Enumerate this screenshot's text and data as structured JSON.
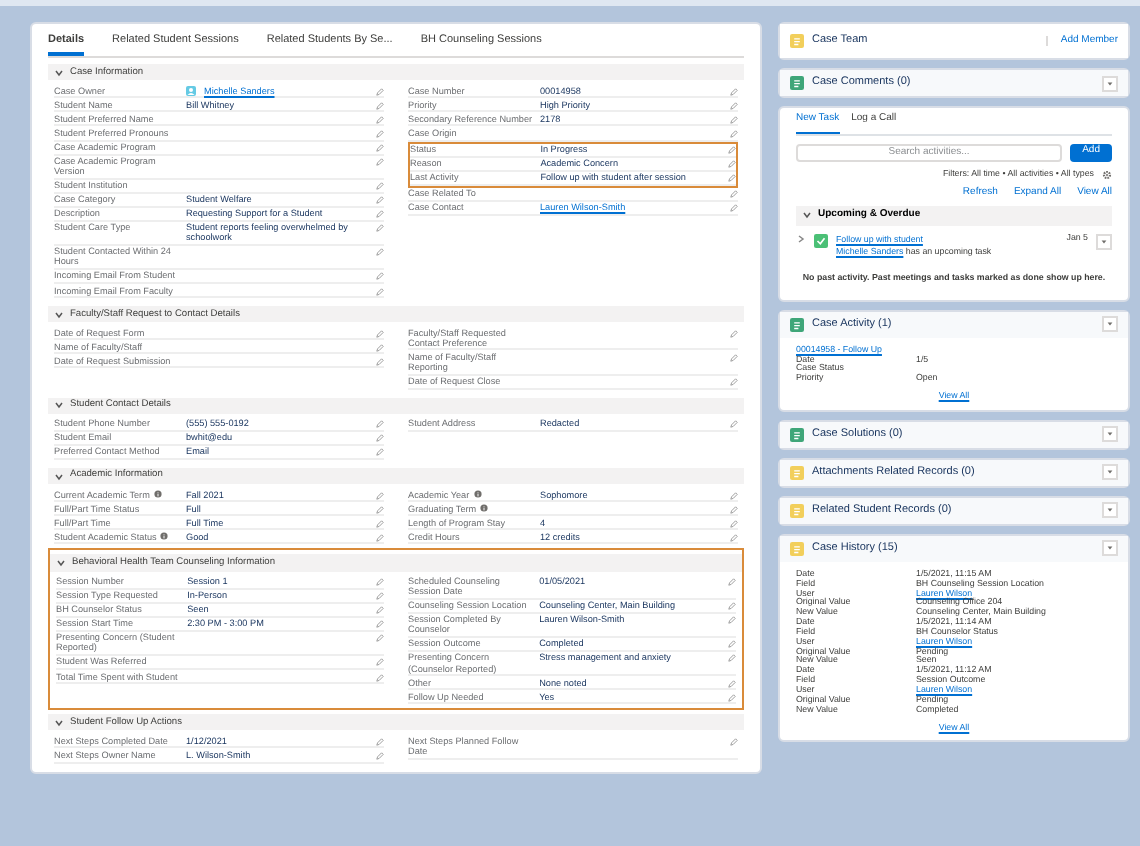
{
  "tabs": [
    {
      "label": "Details",
      "selected": true
    },
    {
      "label": "Related Student Sessions",
      "selected": false
    },
    {
      "label": "Related Students By Se...",
      "selected": false
    },
    {
      "label": "BH Counseling Sessions",
      "selected": false
    }
  ],
  "sections": [
    {
      "title": "Case Information",
      "expanded": true,
      "left": [
        {
          "label": "Case Owner",
          "value": "Michelle Sanders",
          "link": true,
          "user": true
        },
        {
          "label": "Student Name",
          "value": "Bill Whitney"
        },
        {
          "label": "Student Preferred Name"
        },
        {
          "label": "Student Preferred Pronouns"
        },
        {
          "label": "Case Academic Program"
        },
        {
          "label": "Case Academic Program Version"
        },
        {
          "label": "Student Institution"
        },
        {
          "label": "Case Category",
          "value": "Student Welfare"
        },
        {
          "label": "Description",
          "value": "Requesting Support for a Student"
        },
        {
          "label": "Student Care Type",
          "value": "Student reports feeling overwhelmed by schoolwork"
        },
        {
          "label": "Student Contacted Within 24 Hours"
        },
        {
          "label": "Incoming Email From Student"
        },
        {
          "label": "Incoming Email From Faculty"
        }
      ],
      "right": [
        {
          "label": "Case Number",
          "value": "00014958"
        },
        {
          "label": "Priority",
          "value": "High Priority"
        },
        {
          "label": "Secondary Reference Number",
          "value": "2178"
        },
        {
          "label": "Case Origin"
        },
        {
          "label": "Status",
          "value": "In Progress",
          "highlighted": true
        },
        {
          "label": "Reason",
          "value": "Academic Concern",
          "highlighted": true
        },
        {
          "label": "Last Activity",
          "value": "Follow up with student after session",
          "highlighted": true
        },
        {
          "label": "Case Related To"
        },
        {
          "label": "Case Contact",
          "value": "Lauren Wilson-Smith",
          "link": true
        }
      ]
    },
    {
      "title": "Faculty/Staff Request to Contact Details",
      "expanded": true,
      "left": [
        {
          "label": "Date of Request Form"
        },
        {
          "label": "Name of Faculty/Staff"
        },
        {
          "label": "Date of Request Submission"
        }
      ],
      "right": [
        {
          "label": "Faculty/Staff Requested Contact Preference"
        },
        {
          "label": "Name of Faculty/Staff Reporting"
        },
        {
          "label": "Date of Request Close"
        }
      ]
    },
    {
      "title": "Student Contact Details",
      "expanded": true,
      "left": [
        {
          "label": "Student Phone Number",
          "value": "(555) 555-0192"
        },
        {
          "label": "Student Email",
          "value": "bwhit@edu"
        },
        {
          "label": "Preferred Contact Method",
          "value": "Email"
        }
      ],
      "right": [
        {
          "label": "Student Address",
          "value": "Redacted"
        }
      ]
    },
    {
      "title": "Academic Information",
      "expanded": true,
      "left": [
        {
          "label": "Current Academic Term",
          "info": true,
          "value": "Fall 2021"
        },
        {
          "label": "Full/Part Time Status",
          "value": "Full"
        },
        {
          "label": "Full/Part Time",
          "value": "Full Time"
        },
        {
          "label": "Student Academic Status",
          "info": true,
          "value": "Good"
        }
      ],
      "right": [
        {
          "label": "Academic Year",
          "info": true,
          "value": "Sophomore"
        },
        {
          "label": "Graduating Term",
          "info": true
        },
        {
          "label": "Length of Program Stay",
          "value": "4"
        },
        {
          "label": "Credit Hours",
          "value": "12 credits"
        }
      ]
    },
    {
      "title": "Behavioral Health Team Counseling Information",
      "expanded": true,
      "highlighted": true,
      "left": [
        {
          "label": "Session Number",
          "value": "Session 1"
        },
        {
          "label": "Session Type Requested",
          "value": "In-Person"
        },
        {
          "label": "BH Counselor Status",
          "value": "Seen"
        },
        {
          "label": "Session Start Time",
          "value": "2:30 PM - 3:00 PM"
        },
        {
          "label": "Presenting Concern (Student Reported)"
        },
        {
          "label": "Student Was Referred"
        },
        {
          "label": "Total Time Spent with Student"
        }
      ],
      "right": [
        {
          "label": "Scheduled Counseling Session Date",
          "value": "01/05/2021"
        },
        {
          "label": "Counseling Session Location",
          "value": "Counseling Center, Main Building"
        },
        {
          "label": "Session Completed By Counselor",
          "value": "Lauren Wilson-Smith"
        },
        {
          "label": "Session Outcome",
          "value": "Completed"
        },
        {
          "label": "Presenting Concern (Counselor Reported)",
          "value": "Stress management and anxiety"
        },
        {
          "label": "Other",
          "value": "None noted"
        },
        {
          "label": "Follow Up Needed",
          "value": "Yes"
        }
      ]
    },
    {
      "title": "Student Follow Up Actions",
      "expanded": true,
      "left": [
        {
          "label": "Next Steps Completed Date",
          "value": "1/12/2021"
        },
        {
          "label": "Next Steps Owner Name",
          "value": "L. Wilson-Smith"
        }
      ],
      "right": [
        {
          "label": "Next Steps Planned Follow Date"
        }
      ]
    }
  ],
  "side_cards": [
    {
      "kind": "team",
      "title": "Case Team",
      "color": "#f2cf5b",
      "action": "Add Member"
    },
    {
      "kind": "header",
      "title": "Case Comments (0)",
      "color": "#3fa679"
    },
    {
      "kind": "activity",
      "tabs": [
        {
          "label": "New Task",
          "selected": true
        },
        {
          "label": "Log a Call",
          "selected": false
        }
      ],
      "placeholder": "Search activities...",
      "button": "Add",
      "filter": "Filters: All time • All activities • All types",
      "links": [
        "Refresh",
        "Expand All",
        "View All"
      ],
      "group": "Upcoming & Overdue",
      "items": [
        {
          "title": "Follow up with student",
          "who": "Michelle Sanders",
          "rest": "has an upcoming task",
          "date": "Jan 5"
        }
      ],
      "empty": "No past activity. Past meetings and tasks marked as done show up here."
    },
    {
      "kind": "list",
      "title": "Case Activity (1)",
      "color": "#3fa679",
      "records": [
        {
          "link": "00014958 - Follow Up",
          "fields": [
            {
              "label": "Date",
              "value": "1/5"
            },
            {
              "label": "Case Status"
            },
            {
              "label": "Priority",
              "value": "Open"
            }
          ]
        }
      ],
      "footer": "View All"
    },
    {
      "kind": "header",
      "title": "Case Solutions (0)",
      "color": "#3fa679"
    },
    {
      "kind": "header",
      "title": "Attachments Related Records (0)",
      "color": "#f2cf5b"
    },
    {
      "kind": "header",
      "title": "Related Student Records (0)",
      "color": "#f2cf5b"
    },
    {
      "kind": "list",
      "title": "Case History (15)",
      "color": "#f2cf5b",
      "records": [
        {
          "fields": [
            {
              "label": "Date",
              "value": "1/5/2021, 11:15 AM"
            },
            {
              "label": "Field",
              "value": "BH Counseling Session Location"
            },
            {
              "label": "User",
              "value": "Lauren Wilson",
              "link": true
            },
            {
              "label": "Original Value",
              "value": "Counseling Office 204"
            },
            {
              "label": "New Value",
              "value": "Counseling Center, Main Building"
            }
          ]
        },
        {
          "fields": [
            {
              "label": "Date",
              "value": "1/5/2021, 11:14 AM"
            },
            {
              "label": "Field",
              "value": "BH Counselor Status"
            },
            {
              "label": "User",
              "value": "Lauren Wilson",
              "link": true
            },
            {
              "label": "Original Value",
              "value": "Pending"
            },
            {
              "label": "New Value",
              "value": "Seen"
            }
          ]
        },
        {
          "fields": [
            {
              "label": "Date",
              "value": "1/5/2021, 11:12 AM"
            },
            {
              "label": "Field",
              "value": "Session Outcome"
            },
            {
              "label": "User",
              "value": "Lauren Wilson",
              "link": true
            },
            {
              "label": "Original Value",
              "value": "Pending"
            },
            {
              "label": "New Value",
              "value": "Completed"
            }
          ]
        }
      ],
      "footer": "View All"
    }
  ]
}
